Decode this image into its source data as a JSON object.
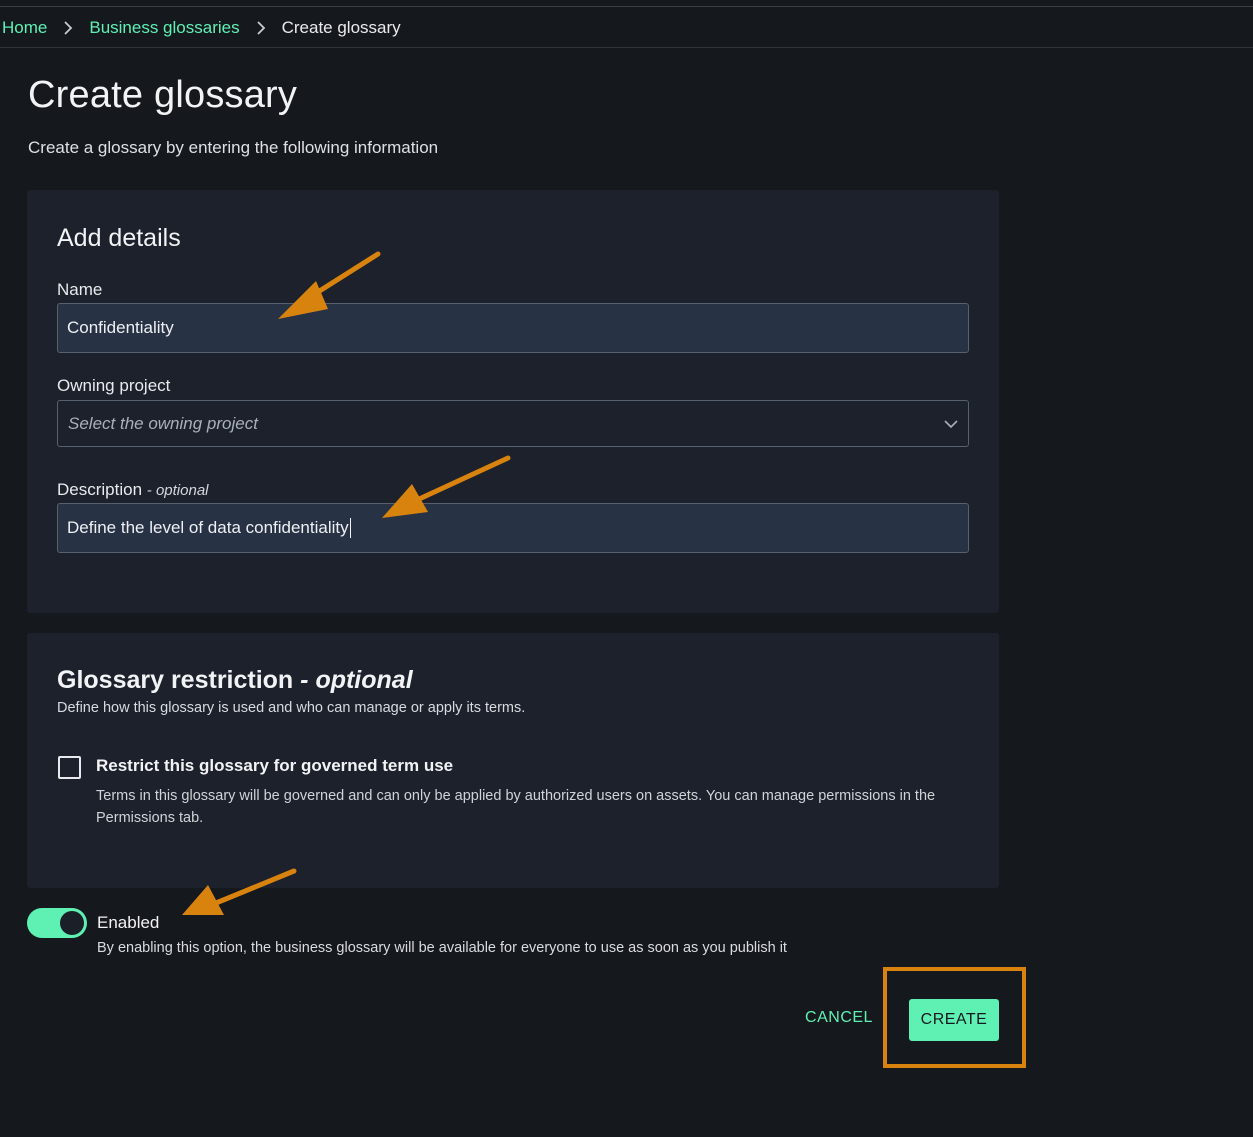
{
  "breadcrumb": {
    "home": "Home",
    "glossaries": "Business glossaries",
    "current": "Create glossary"
  },
  "header": {
    "title": "Create glossary",
    "subtitle": "Create a glossary by entering the following information"
  },
  "details": {
    "title": "Add details",
    "name_label": "Name",
    "name_value": "Confidentiality",
    "project_label": "Owning project",
    "project_placeholder": "Select the owning project",
    "description_label": "Description",
    "description_optional": "- optional",
    "description_value": "Define the level of data confidentiality"
  },
  "restriction": {
    "title": "Glossary restriction",
    "title_optional": "- optional",
    "description": "Define how this glossary is used and who can manage or apply its terms.",
    "checkbox_label": "Restrict this glossary for governed term use",
    "checkbox_checked": false,
    "checkbox_description": "Terms in this glossary will be governed and can only be applied by authorized users on assets. You can manage permissions in the Permissions tab."
  },
  "enabled": {
    "label": "Enabled",
    "state": true,
    "description": "By enabling this option, the business glossary will be available for everyone to use as soon as you publish it"
  },
  "actions": {
    "cancel": "CANCEL",
    "create": "CREATE"
  },
  "colors": {
    "accent": "#5ff0b4",
    "annotation": "#d9830f",
    "background": "#15181d",
    "panel": "#1c212b",
    "input": "#283245"
  },
  "icons": {
    "breadcrumb_separator": "chevron-right-icon",
    "select_dropdown": "chevron-down-icon",
    "annotation": "arrow-annotation-icon"
  }
}
